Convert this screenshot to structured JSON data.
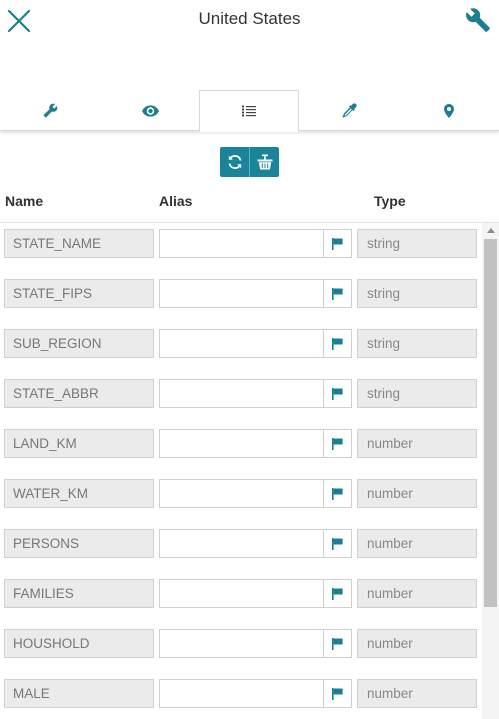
{
  "header": {
    "title": "United States",
    "close_icon": "close-icon",
    "settings_icon": "wrench-icon"
  },
  "tabs": [
    {
      "icon": "wrench-icon",
      "active": false
    },
    {
      "icon": "eye-icon",
      "active": false
    },
    {
      "icon": "list-icon",
      "active": true
    },
    {
      "icon": "eyedropper-icon",
      "active": false
    },
    {
      "icon": "map-pin-icon",
      "active": false
    }
  ],
  "actions": {
    "refresh_icon": "refresh-icon",
    "clear_icon": "clear-basket-icon"
  },
  "columns": {
    "name": "Name",
    "alias": "Alias",
    "type": "Type"
  },
  "fields": [
    {
      "name": "STATE_NAME",
      "alias": "",
      "type": "string"
    },
    {
      "name": "STATE_FIPS",
      "alias": "",
      "type": "string"
    },
    {
      "name": "SUB_REGION",
      "alias": "",
      "type": "string"
    },
    {
      "name": "STATE_ABBR",
      "alias": "",
      "type": "string"
    },
    {
      "name": "LAND_KM",
      "alias": "",
      "type": "number"
    },
    {
      "name": "WATER_KM",
      "alias": "",
      "type": "number"
    },
    {
      "name": "PERSONS",
      "alias": "",
      "type": "number"
    },
    {
      "name": "FAMILIES",
      "alias": "",
      "type": "number"
    },
    {
      "name": "HOUSHOLD",
      "alias": "",
      "type": "number"
    },
    {
      "name": "MALE",
      "alias": "",
      "type": "number"
    }
  ],
  "colors": {
    "accent": "#1a8599",
    "icon": "#1a7f93"
  }
}
